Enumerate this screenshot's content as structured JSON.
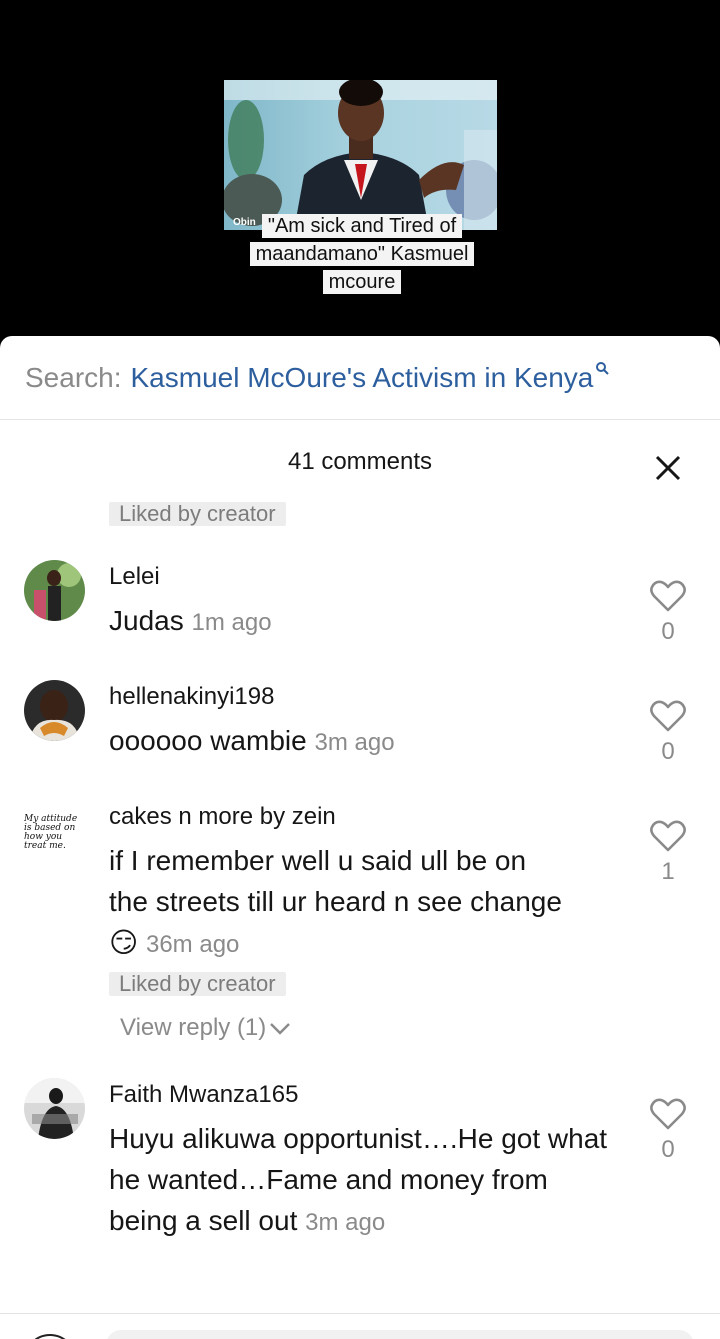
{
  "video": {
    "overlay_small": "Obin",
    "caption_lines": [
      "\"Am sick and Tired of",
      "maandamano\" Kasmuel",
      "mcoure"
    ]
  },
  "search": {
    "prefix": "Search:",
    "term": "Kasmuel McOure's Activism in Kenya"
  },
  "header": {
    "comments_count": "41 comments"
  },
  "top_badge": "Liked by creator",
  "comments": [
    {
      "username": "Lelei",
      "text": "Judas",
      "time": "1m ago",
      "likes": "0"
    },
    {
      "username": "hellenakinyi198",
      "text": "oooooo wambie",
      "time": "3m ago",
      "likes": "0"
    },
    {
      "username": "cakes n more by zein",
      "avatar_text": "My attitude is based on how you treat me.",
      "text": "if I remember well u said ull be on the streets till ur heard n see change 😏",
      "time": "36m ago",
      "likes": "1",
      "badge": "Liked by creator",
      "view_reply": "View reply (1)"
    },
    {
      "username": "Faith Mwanza165",
      "text": "Huyu alikuwa opportunist….He got what he wanted…Fame and money from being a sell out",
      "time": "3m ago",
      "likes": "0"
    }
  ]
}
